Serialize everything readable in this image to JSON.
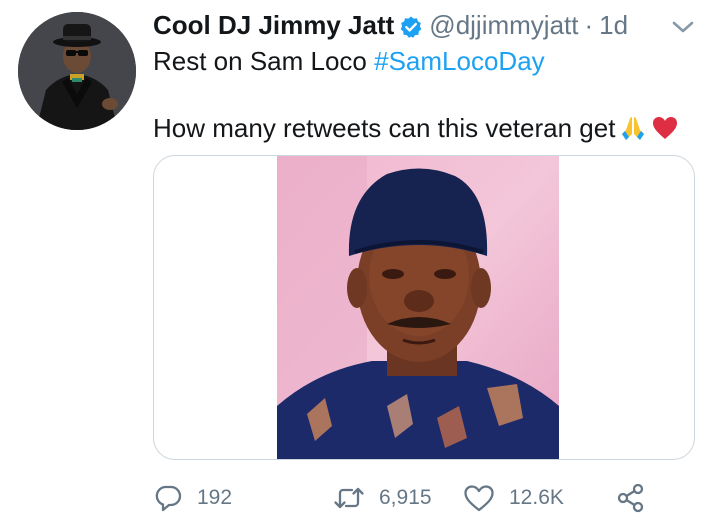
{
  "tweet": {
    "display_name": "Cool DJ Jimmy Jatt",
    "handle": "@djjimmyjatt",
    "separator": "·",
    "time": "1d",
    "text_line1": "Rest on Sam Loco ",
    "hashtag": "#SamLocoDay",
    "text_line2": "How many retweets can this veteran get",
    "emojis": [
      "folded-hands",
      "red-heart"
    ]
  },
  "actions": {
    "replies": "192",
    "retweets": "6,915",
    "likes": "12.6K"
  },
  "colors": {
    "link": "#1da1f2",
    "muted": "#657786",
    "verified": "#1da1f2",
    "border": "#ccd6dd"
  }
}
